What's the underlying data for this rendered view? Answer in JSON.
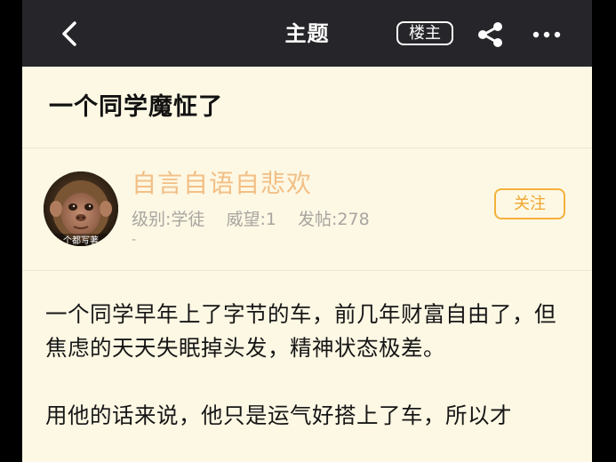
{
  "header": {
    "title": "主题",
    "owner_badge": "楼主"
  },
  "thread": {
    "title": "一个同学魔怔了"
  },
  "author": {
    "name": "自言自语自悲欢",
    "level": "级别:学徒",
    "prestige": "威望:1",
    "posts": "发帖:278",
    "signature": "-",
    "avatar_caption": "个都写著",
    "follow_label": "关注"
  },
  "post": {
    "paragraphs": [
      "一个同学早年上了字节的车，前几年财富自由了，但焦虑的天天失眠掉头发，精神状态极差。",
      "用他的话来说，他只是运气好搭上了车，所以才"
    ]
  },
  "colors": {
    "topbar_bg": "#26262a",
    "page_bg": "#fdf8e4",
    "author_name": "#f2bf86",
    "follow_accent": "#f5b03c"
  },
  "icons": {
    "back": "chevron-left-icon",
    "share": "share-icon",
    "more": "more-dots-icon"
  }
}
